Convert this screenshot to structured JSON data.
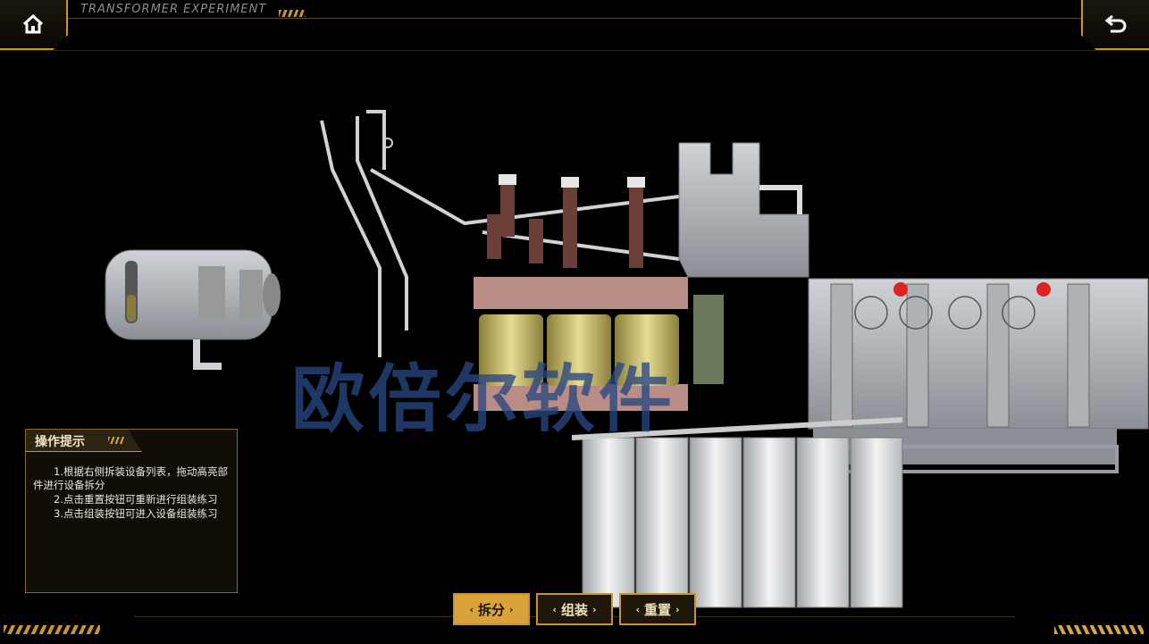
{
  "header": {
    "title": "TRANSFORMER EXPERIMENT",
    "home_icon": "home-icon",
    "back_icon": "return-icon"
  },
  "tips": {
    "title": "操作提示",
    "items": [
      "1.根据右侧拆装设备列表，拖动高亮部件进行设备拆分",
      "2.点击重置按钮可重新进行组装练习",
      "3.点击组装按钮可进入设备组装练习"
    ]
  },
  "controls": {
    "disassemble": "拆分",
    "assemble": "组装",
    "reset": "重置",
    "active": "disassemble"
  },
  "watermark": "欧倍尔软件",
  "colors": {
    "accent": "#c8942e",
    "active_button": "#d9a23a",
    "background": "#000000"
  }
}
